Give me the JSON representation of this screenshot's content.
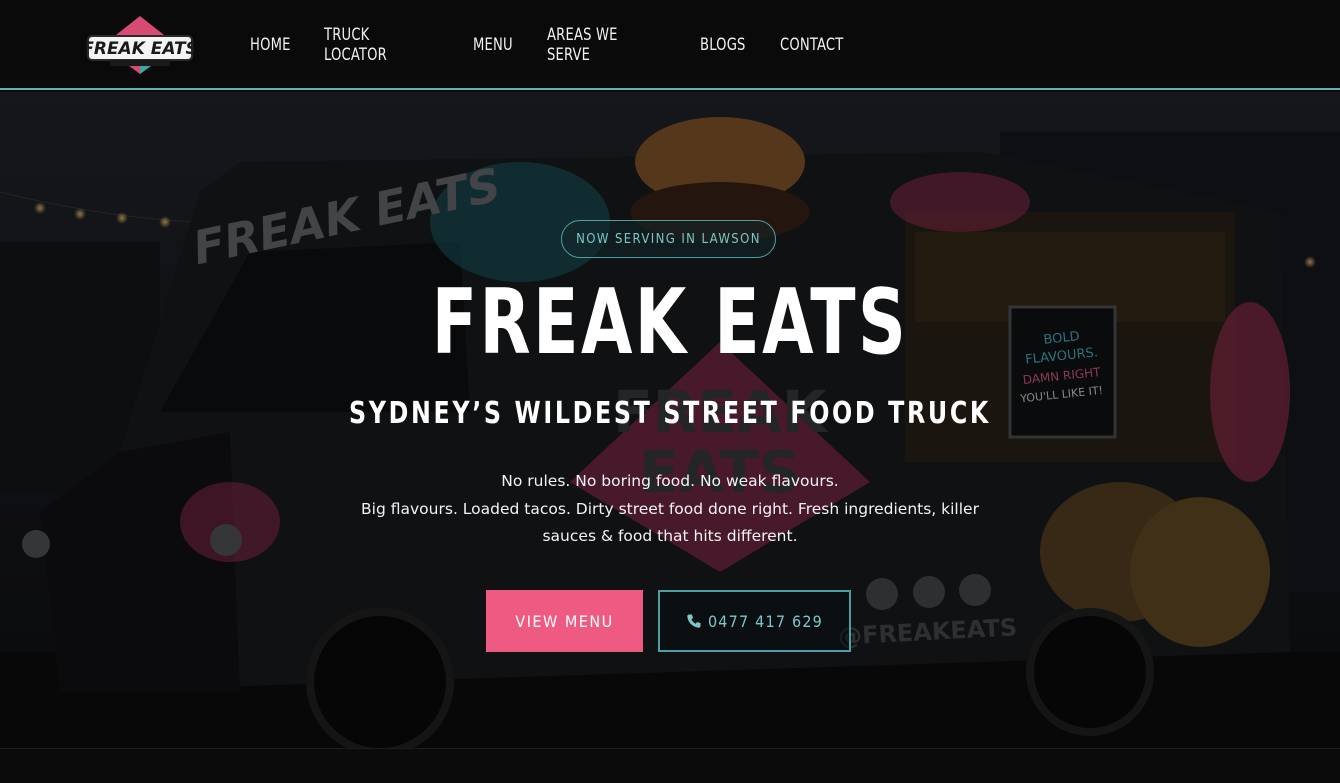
{
  "brand": {
    "logo_text": "FREAK EATS",
    "logo_tagline": "DAMN RIGHT YOU'LL LIKE IT!",
    "colors": {
      "accent_pink": "#ef5a83",
      "accent_teal": "#4f9fa0",
      "background": "#0a0a0a"
    }
  },
  "nav": {
    "items": [
      {
        "label": "HOME"
      },
      {
        "label": "TRUCK LOCATOR"
      },
      {
        "label": "MENU"
      },
      {
        "label": "AREAS WE SERVE"
      },
      {
        "label": "BLOGS"
      },
      {
        "label": "CONTACT"
      }
    ]
  },
  "hero": {
    "badge": "NOW SERVING IN LAWSON",
    "title": "FREAK EATS",
    "subtitle": "SYDNEY’S WILDEST STREET FOOD TRUCK",
    "description": [
      "No rules. No boring food. No weak flavours.",
      "Big flavours. Loaded tacos. Dirty street food done right. Fresh ingredients, killer",
      "sauces & food that hits different."
    ],
    "primary_button": "VIEW MENU",
    "phone_button": "0477 417 629",
    "phone_icon": "phone-icon",
    "background_text": {
      "truck_side": "FREAK EATS",
      "board_line1": "BOLD",
      "board_line2": "FLAVOURS.",
      "board_line3": "DAMN RIGHT",
      "board_line4": "YOU'LL LIKE IT!",
      "handle": "@FREAKEATS"
    }
  }
}
